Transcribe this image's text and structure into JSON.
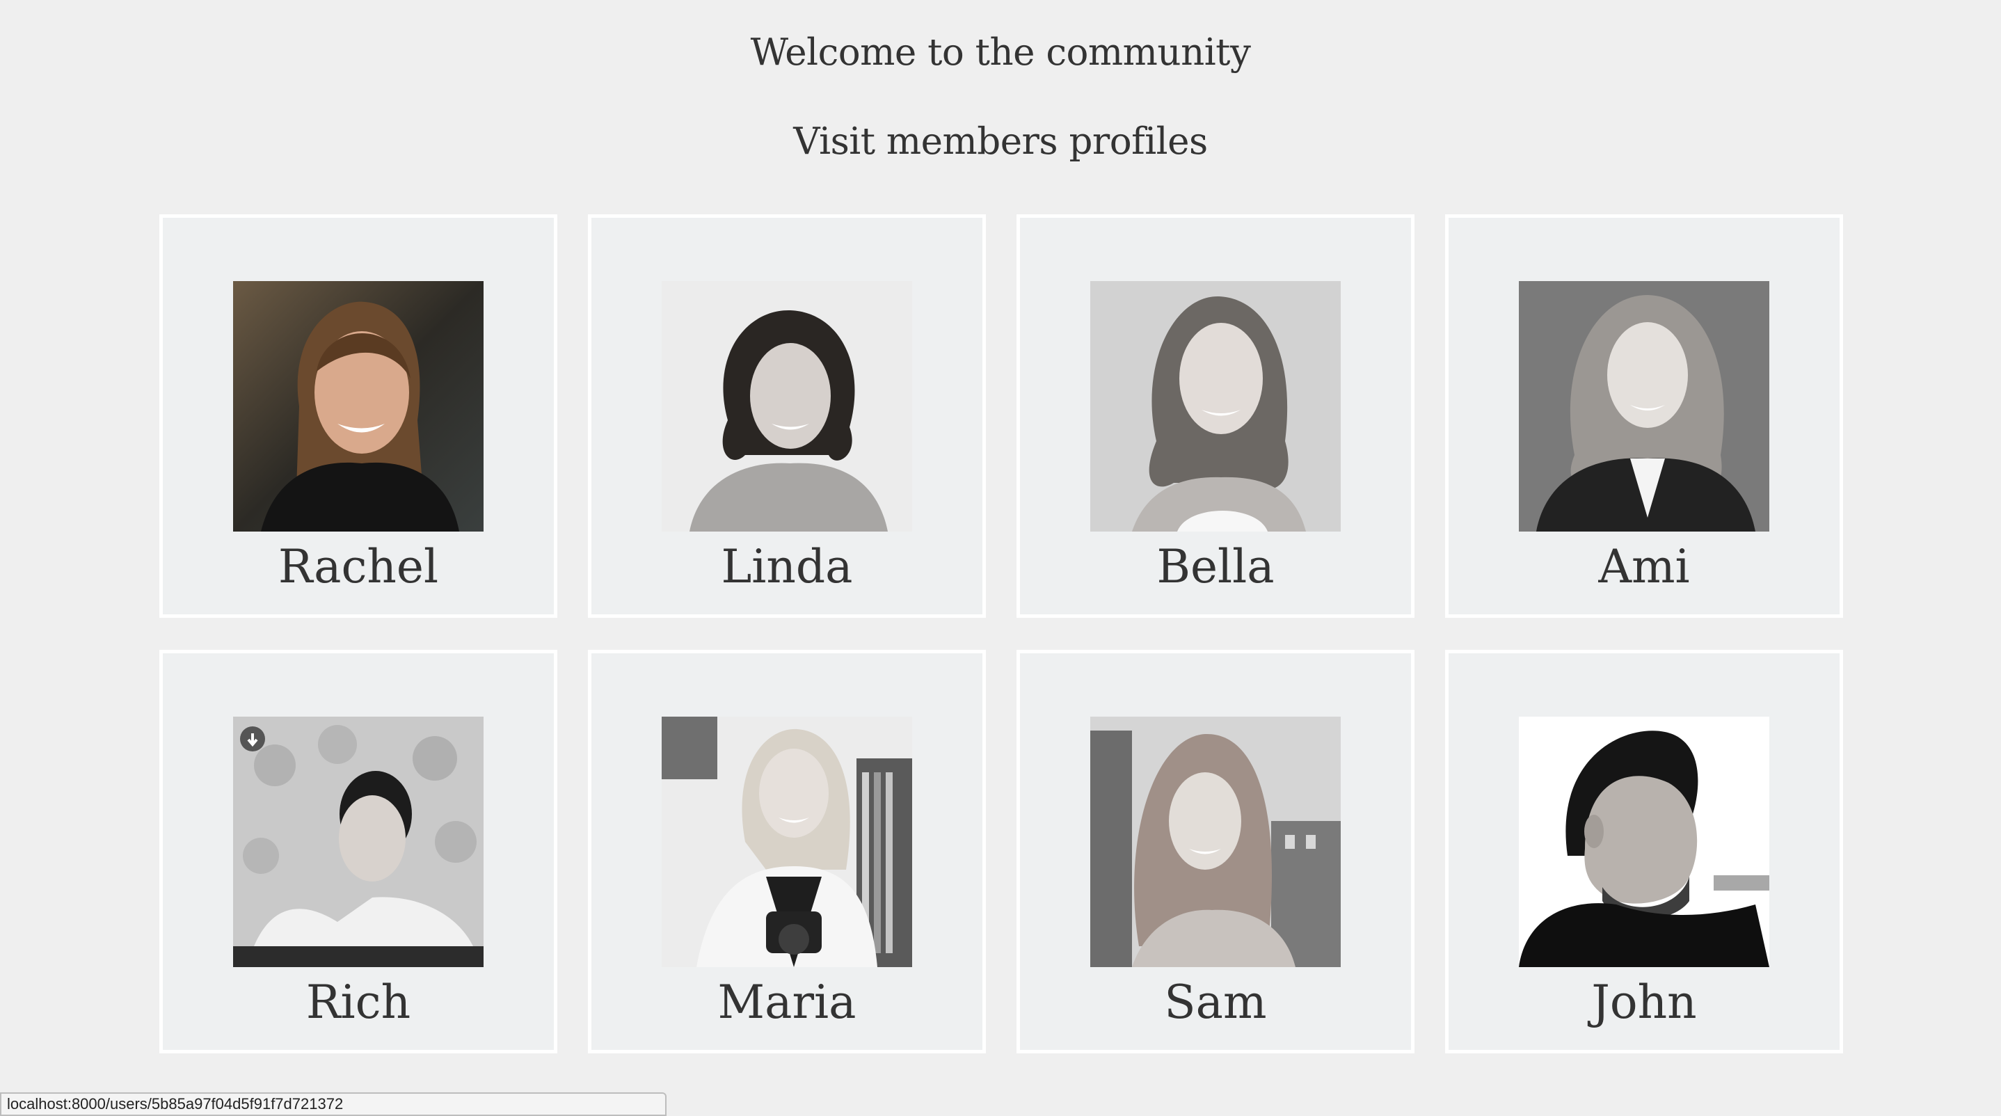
{
  "header": {
    "title": "Welcome to the community",
    "subtitle": "Visit members profiles"
  },
  "members": [
    {
      "name": "Rachel",
      "photo": "portrait-photo-icon"
    },
    {
      "name": "Linda",
      "photo": "portrait-photo-icon"
    },
    {
      "name": "Bella",
      "photo": "portrait-photo-icon"
    },
    {
      "name": "Ami",
      "photo": "portrait-photo-icon"
    },
    {
      "name": "Rich",
      "photo": "portrait-photo-icon"
    },
    {
      "name": "Maria",
      "photo": "portrait-photo-icon"
    },
    {
      "name": "Sam",
      "photo": "portrait-photo-icon"
    },
    {
      "name": "John",
      "photo": "portrait-photo-icon"
    }
  ],
  "status_bar": {
    "url": "localhost:8000/users/5b85a97f04d5f91f7d721372"
  },
  "colors": {
    "background": "#efefef",
    "card_border": "#ffffff",
    "text": "#333333"
  }
}
